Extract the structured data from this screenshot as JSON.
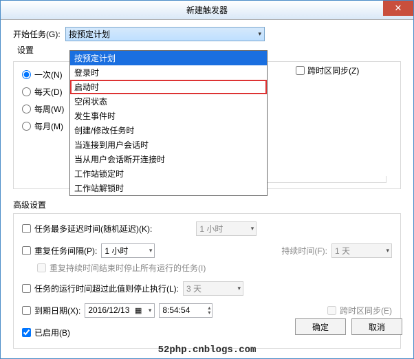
{
  "window": {
    "title": "新建触发器",
    "close": "✕"
  },
  "begin": {
    "label": "开始任务(G):",
    "value": "按预定计划"
  },
  "settings_label": "设置",
  "dropdown_items": [
    "按预定计划",
    "登录时",
    "启动时",
    "空闲状态",
    "发生事件时",
    "创建/修改任务时",
    "当连接到用户会话时",
    "当从用户会话断开连接时",
    "工作站锁定时",
    "工作站解锁时"
  ],
  "schedule": {
    "once": "一次(N)",
    "daily": "每天(D)",
    "weekly": "每周(W)",
    "monthly": "每月(M)",
    "tz_sync": "跨时区同步(Z)"
  },
  "advanced": {
    "title": "高级设置",
    "delay_label": "任务最多延迟时间(随机延迟)(K):",
    "delay_value": "1 小时",
    "repeat_label": "重复任务间隔(P):",
    "repeat_value": "1 小时",
    "duration_label": "持续时间(F):",
    "duration_value": "1 天",
    "stop_after_repeat": "重复持续时间结束时停止所有运行的任务(I)",
    "stop_label": "任务的运行时间超过此值则停止执行(L):",
    "stop_value": "3 天",
    "expire_label": "到期日期(X):",
    "expire_date": "2016/12/13",
    "expire_time": "8:54:54",
    "expire_tz": "跨时区同步(E)",
    "enabled": "已启用(B)"
  },
  "buttons": {
    "ok": "确定",
    "cancel": "取消"
  },
  "watermark": "52php.cnblogs.com"
}
